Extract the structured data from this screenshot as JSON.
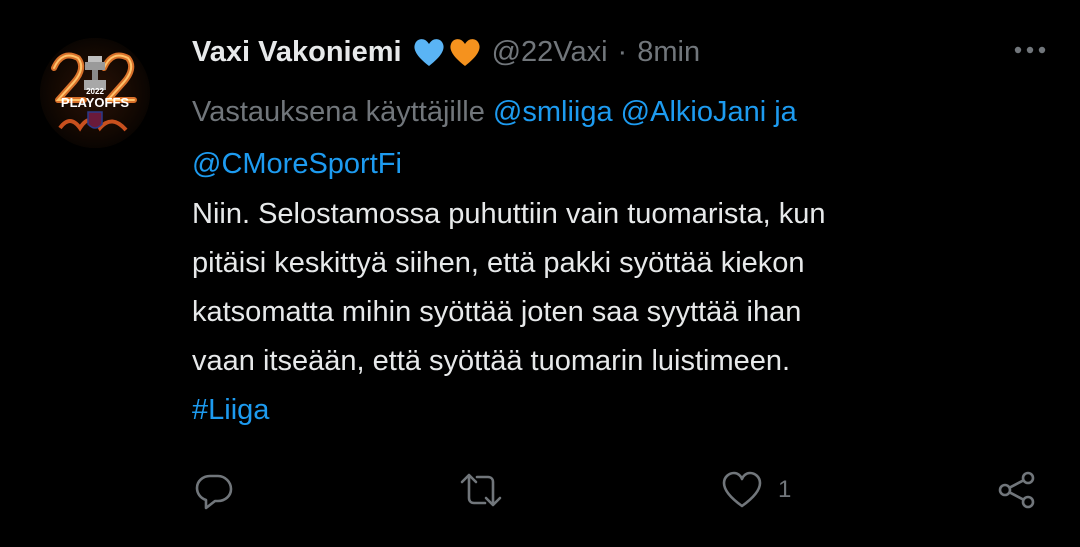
{
  "tweet": {
    "author_name": "Vaxi Vakoniemi",
    "handle": "@22Vaxi",
    "separator": "·",
    "time": "8min",
    "avatar": {
      "badge_text": "PLAYOFFS",
      "year_text": "2022"
    },
    "reply_to": {
      "prefix": "Vastauksena käyttäjille",
      "mention_1": "@smliiga",
      "mention_2": "@AlkioJani",
      "conjunction": "ja",
      "mention_3": "@CMoreSportFi"
    },
    "text_lines": [
      "Niin. Selostamossa puhuttiin vain tuomarista, kun",
      "pitäisi keskittyä siihen, että pakki syöttää kiekon",
      "katsomatta mihin syöttää joten saa syyttää ihan",
      "vaan itseään, että syöttää tuomarin luistimeen."
    ],
    "hashtag": "#Liiga",
    "like_count": "1"
  },
  "icons": {
    "heart_blue": "blue-heart-icon",
    "heart_orange": "orange-heart-icon",
    "more": "more-icon",
    "reply": "reply-icon",
    "retweet": "retweet-icon",
    "like": "like-icon",
    "share": "share-icon"
  },
  "colors": {
    "background": "#000000",
    "text_primary": "#e7e9ea",
    "text_secondary": "#71767b",
    "link": "#1d9bf0",
    "heart_blue": "#5ab4f5",
    "heart_orange": "#f5921e"
  }
}
